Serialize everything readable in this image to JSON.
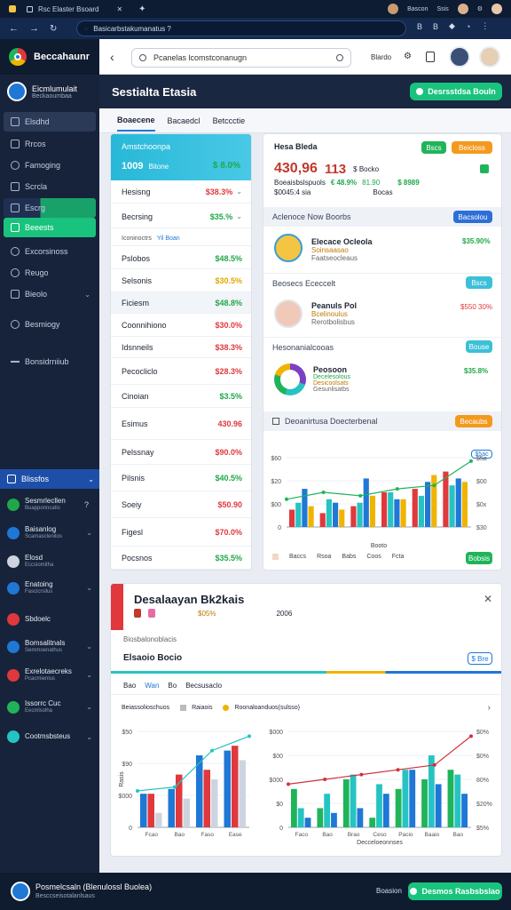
{
  "browser": {
    "tab_title": "Rsc Elaster Bsoard",
    "url": "Basicarbstakumanatus ?"
  },
  "app": {
    "brand": "Beccahaunr",
    "search_placeholder": "Pcanelas lcomstconanugn",
    "header_link": "Blardo"
  },
  "sidebar": {
    "profile": {
      "title": "Eicmlumulait",
      "subtitle": "Beckaoumbaa"
    },
    "items": [
      {
        "label": "Elsdhd",
        "icon": "grid-icon",
        "active": true
      },
      {
        "label": "Rrcos",
        "icon": "chart-icon"
      },
      {
        "label": "Famoging",
        "icon": "chat-icon"
      },
      {
        "label": "Scrcla",
        "icon": "lock-icon"
      },
      {
        "label": "Escrg",
        "icon": "badge-icon",
        "selected": true
      },
      {
        "label": "Beeests",
        "icon": "dashboard-icon",
        "highlight": true
      },
      {
        "label": "Excorsinoss",
        "icon": "message-icon"
      },
      {
        "label": "Reugo",
        "icon": "chat-icon"
      },
      {
        "label": "Bieolo",
        "icon": "settings-icon"
      },
      {
        "label": "Besmiogy",
        "icon": "chat-icon"
      },
      {
        "label": "Bonsidrniiub",
        "icon": "minus-icon"
      }
    ],
    "section": {
      "label": "Blissfos"
    },
    "lower_items": [
      {
        "title": "Sesmrlecllen",
        "subtitle": "Buapponncatis",
        "suffix": "?"
      },
      {
        "title": "Baisanlog",
        "subtitle": "Scamasclenitos"
      },
      {
        "title": "Elosd",
        "subtitle": "Eccsiomitha"
      },
      {
        "title": "Enatoing",
        "subtitle": "Fascicrsilus"
      },
      {
        "title": "Sbdoelc"
      },
      {
        "title": "Bomsalitnals",
        "subtitle": "Semmoenathus"
      },
      {
        "title": "Exrelotaecreks",
        "subtitle": "Pcacmienlus"
      },
      {
        "title": "Issorrc Cuc",
        "subtitle": "Eecmlsolha"
      },
      {
        "title": "Cootmsbsteus"
      }
    ]
  },
  "main": {
    "title": "Sestialta Etasia",
    "action_label": "Desrsstdsa Bouln",
    "tabs": [
      "Boaecene",
      "Bacaedcl",
      "Betccctie"
    ]
  },
  "left_card": {
    "header_title": "Amstchoonpa",
    "header_value": "1009",
    "header_sub": "Bitone",
    "header_change": "$ 8.0%",
    "rows_top": [
      {
        "label": "Hesisng",
        "value": "$38.3%",
        "tone": "neg"
      },
      {
        "label": "Becrsing",
        "value": "$35.%",
        "tone": "pos"
      }
    ],
    "subsection": {
      "label": "Iconinoctrs",
      "link": "Yil Boan"
    },
    "rows": [
      {
        "label": "Pslobos",
        "value": "$48.5%",
        "tone": "pos"
      },
      {
        "label": "Selsonis",
        "value": "$30.5%",
        "tone": "amb"
      },
      {
        "label": "Ficiesm",
        "value": "$48.8%",
        "tone": "pos"
      },
      {
        "label": "Coonnihiono",
        "value": "$30.0%",
        "tone": "neg"
      },
      {
        "label": "Idsnneils",
        "value": "$38.3%",
        "tone": "neg"
      },
      {
        "label": "Pecocliclo",
        "value": "$28.3%",
        "tone": "neg"
      },
      {
        "label": "Cinoian",
        "value": "$3.5%",
        "tone": "pos"
      },
      {
        "label": "Esimus",
        "value": "430.96",
        "tone": "neg"
      },
      {
        "label": "Pelssnay",
        "value": "$90.0%",
        "tone": "neg"
      },
      {
        "label": "Pilsnis",
        "value": "$40.5%",
        "tone": "pos"
      },
      {
        "label": "Soeiy",
        "value": "$50.90",
        "tone": "neg"
      },
      {
        "label": "Figesl",
        "value": "$70.0%",
        "tone": "neg"
      },
      {
        "label": "Pocsnos",
        "value": "$35.5%",
        "tone": "pos"
      }
    ]
  },
  "right_card": {
    "title": "Hesa Bleda",
    "btn_green": "Bscs",
    "btn_orange": "Beicloss",
    "kpi_main": "430,96",
    "kpi_second": "113",
    "kpi_second_sub": "$ Bocko",
    "kpi_meta": "Boeaisbslspuols",
    "kpi_change": "€ 48.9%",
    "kpi_change2": "81.90",
    "kpi_meta2": "$0045:4 sia",
    "kpi_right_value": "$ 8989",
    "kpi_right_sub": "Bocas",
    "section1": {
      "label": "Aclenoce Now Boorbs",
      "button": "Bacsolou"
    },
    "person1": {
      "name": "Elecace Ocleola",
      "line1": "Soinsaasao",
      "line2": "Faatseocleaus",
      "value": "$35.90%",
      "tone": "pos"
    },
    "section2": {
      "label": "Beosecs Ececcelt",
      "button": "Bscs"
    },
    "person2": {
      "name": "Peanuls Pol",
      "line1": "Bcelinoulus",
      "line2": "Rerotbolisbus",
      "value": "$550 30%",
      "tone": "neg"
    },
    "section3": {
      "label": "Hesonanialcooas",
      "button": "Bouse"
    },
    "donut": {
      "title": "Peosoon",
      "line1": "Decelesolous",
      "line2": "Desicoolsats",
      "line3": "Gesunlisatbs",
      "value": "$35.8%"
    },
    "chart_header": {
      "label": "Deoanirtusa Doecterbenal",
      "button": "Becaubs"
    },
    "legend": [
      "Baccs",
      "Rsoa",
      "Babs",
      "Coos",
      "Fcta"
    ],
    "chart_button": "Bobsis",
    "chart_badge": "$5ac"
  },
  "bottom_card": {
    "title": "Desalaayan Bk2kais",
    "year": "2006",
    "sub_value": "$05%",
    "meta": "Biosbalonoblacis",
    "section_title": "Elsaoio Bocio",
    "section_button": "$ Bre",
    "filters": [
      "Bao",
      "Wan",
      "Bo",
      "Becsusaclo"
    ],
    "legend_title": "Beiassolioschuos",
    "legend_a": "Raiaois",
    "legend_b": "Roonaloanduos(sulsso)"
  },
  "footer": {
    "title": "Posmelcsaln (Blenulossl Buolea)",
    "subtitle": "Besccseisotalanlsaus",
    "link": "Boasion",
    "button": "Desmos Rasbsbslao"
  },
  "chart_data": [
    {
      "type": "bar",
      "series": [
        {
          "color": "#e0383c",
          "values": [
            25,
            20,
            30,
            50,
            55,
            80
          ]
        },
        {
          "color": "#25c4c2",
          "values": [
            35,
            40,
            35,
            50,
            45,
            60
          ]
        },
        {
          "color": "#1f77d6",
          "values": [
            55,
            35,
            70,
            40,
            65,
            70
          ]
        },
        {
          "color": "#f0b400",
          "values": [
            30,
            25,
            45,
            40,
            75,
            65
          ]
        }
      ],
      "yticks_left": [
        "$60",
        "$20",
        "$00",
        "0"
      ],
      "yticks_right": [
        "$5a",
        "$00",
        "$0x",
        "$30"
      ],
      "xlabel": "Booto",
      "line": {
        "color": "#20b45a",
        "values": [
          40,
          50,
          45,
          55,
          60,
          95
        ]
      }
    },
    {
      "type": "bar",
      "series": [
        {
          "color": "#1f77d6",
          "values": [
            35,
            40,
            75,
            80
          ]
        },
        {
          "color": "#e0383c",
          "values": [
            35,
            55,
            60,
            85
          ]
        },
        {
          "color": "#cdd4df",
          "values": [
            15,
            30,
            50,
            70
          ]
        }
      ],
      "categories": [
        "Fcao",
        "Bao",
        "Faso",
        "Ease"
      ],
      "yticks": [
        "$50",
        "$90",
        "$000",
        "0"
      ],
      "ylabel": "Rasis",
      "line": {
        "color": "#25c4c2",
        "values": [
          38,
          42,
          80,
          95
        ]
      }
    },
    {
      "type": "bar",
      "series": [
        {
          "color": "#20b45a",
          "values": [
            40,
            20,
            50,
            10,
            40,
            50,
            60
          ]
        },
        {
          "color": "#25c4c2",
          "values": [
            20,
            35,
            55,
            45,
            60,
            75,
            55
          ]
        },
        {
          "color": "#1f77d6",
          "values": [
            10,
            15,
            20,
            35,
            60,
            45,
            35
          ]
        }
      ],
      "categories": [
        "Faco",
        "Bao",
        "Brao",
        "Ceso",
        "Pacio",
        "Baaio",
        "Bao"
      ],
      "yticks_left": [
        "$000",
        "$00",
        "$000",
        "$0",
        "0"
      ],
      "yticks_right": [
        "$0%",
        "$0%",
        "80%",
        "$20%",
        "$5%"
      ],
      "xlabel": "Decceloeonnses",
      "line": {
        "color": "#d0313c",
        "values": [
          45,
          50,
          55,
          60,
          65,
          95
        ]
      }
    }
  ]
}
